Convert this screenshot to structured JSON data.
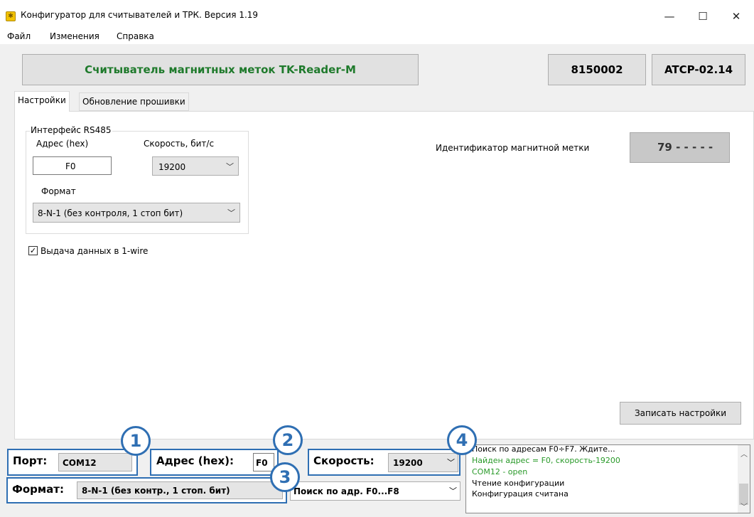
{
  "window": {
    "title": "Конфигуратор  для считывателей и ТРК.  Версия 1.19",
    "controls": {
      "minimize": "—",
      "maximize": "☐",
      "close": "✕"
    }
  },
  "menu": [
    "Файл",
    "Изменения",
    "Справка"
  ],
  "header": {
    "device_name": "Считыватель магнитных меток TK-Reader-M",
    "serial": "8150002",
    "firmware": "ATCP-02.14"
  },
  "tabs": [
    "Настройки",
    "Обновление прошивки"
  ],
  "rs485": {
    "group_title": "Интерфейс RS485",
    "address_label": "Адрес (hex)",
    "address_value": "F0",
    "speed_label": "Скорость, бит/с",
    "speed_value": "19200",
    "format_label": "Формат",
    "format_value": "8-N-1 (без контроля, 1 стоп бит)"
  },
  "onewire": {
    "checked": true,
    "check_mark": "✓",
    "label": "Выдача данных в 1-wire"
  },
  "tag_id": {
    "label": "Идентификатор магнитной метки",
    "value": "79 - - - - -"
  },
  "save_button": "Записать настройки",
  "bottom": {
    "port_label": "Порт:",
    "port_value": "COM12",
    "address_label": "Адрес (hex):",
    "address_value": "F0",
    "speed_label": "Скорость:",
    "speed_value": "19200",
    "format_label": "Формат:",
    "format_value": "8-N-1 (без контр., 1 стоп. бит)",
    "search_value": "Поиск по адр. F0...F8"
  },
  "callouts": [
    "1",
    "2",
    "3",
    "4"
  ],
  "log": {
    "lines": [
      {
        "text": "Поиск по адресам F0÷F7. Ждите...",
        "color": "#000000"
      },
      {
        "text": "Найден адрес = F0, скорость-19200",
        "color": "#2a9a2a"
      },
      {
        "text": "COM12 - open",
        "color": "#2a9a2a"
      },
      {
        "text": "Чтение конфигурации",
        "color": "#000000"
      },
      {
        "text": "Конфигурация считана",
        "color": "#000000"
      }
    ]
  },
  "colors": {
    "device_green": "#1f7a2c",
    "callout_blue": "#2f6fb3"
  }
}
